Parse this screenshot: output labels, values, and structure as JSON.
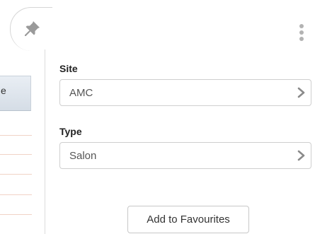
{
  "left_table": {
    "header_text": "e"
  },
  "panel": {
    "site": {
      "label": "Site",
      "value": "AMC"
    },
    "type": {
      "label": "Type",
      "value": "Salon"
    },
    "add_button_label": "Add to Favourites"
  },
  "icons": {
    "pin": "pushpin-icon",
    "more": "more-vertical-icon",
    "chevron": "chevron-right-icon"
  },
  "colors": {
    "header_bg": "#dfe6ee",
    "row_line": "#f1d3c6",
    "icon_gray": "#b3b3b3"
  }
}
